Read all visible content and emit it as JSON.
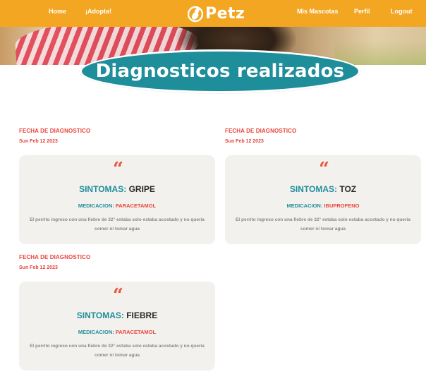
{
  "nav": {
    "home": "Home",
    "adopta": "¡Adopta!",
    "logo_text": "Petz",
    "mascotas": "Mis Mascotas",
    "perfil": "Perfil",
    "logout": "Logout"
  },
  "page_title": "Diagnosticos realizados",
  "diagnoses": [
    {
      "date_label": "FECHA DE DIAGNOSTICO",
      "date": "Sun Feb 12 2023",
      "quote": "“",
      "sintomas_label": "SINTOMAS:",
      "sintomas": "GRIPE",
      "medicacion_label": "MEDICACION:",
      "medicacion": "PARACETAMOL",
      "description": "El perrito ingreso con una fiebre de 32° estaba solo estaba acostado y no quería comer ni tomar agua"
    },
    {
      "date_label": "FECHA DE DIAGNOSTICO",
      "date": "Sun Feb 12 2023",
      "quote": "“",
      "sintomas_label": "SINTOMAS:",
      "sintomas": "TOZ",
      "medicacion_label": "MEDICACION:",
      "medicacion": "IBUPROFENO",
      "description": "El perrito ingreso con una fiebre de 32° estaba solo estaba acostado y no quería comer ni tomar agua"
    },
    {
      "date_label": "FECHA DE DIAGNOSTICO",
      "date": "Sun Feb 12 2023",
      "quote": "“",
      "sintomas_label": "SINTOMAS:",
      "sintomas": "FIEBRE",
      "medicacion_label": "MEDICACION:",
      "medicacion": "PARACETAMOL",
      "description": "El perrito ingreso con una fiebre de 32° estaba solo estaba acostado y no quería comer ni tomar agua"
    }
  ],
  "colors": {
    "nav_bg": "#f3a622",
    "teal": "#1f8e9b",
    "accent_red": "#e8453c",
    "card_bg": "#f3f1ed"
  }
}
